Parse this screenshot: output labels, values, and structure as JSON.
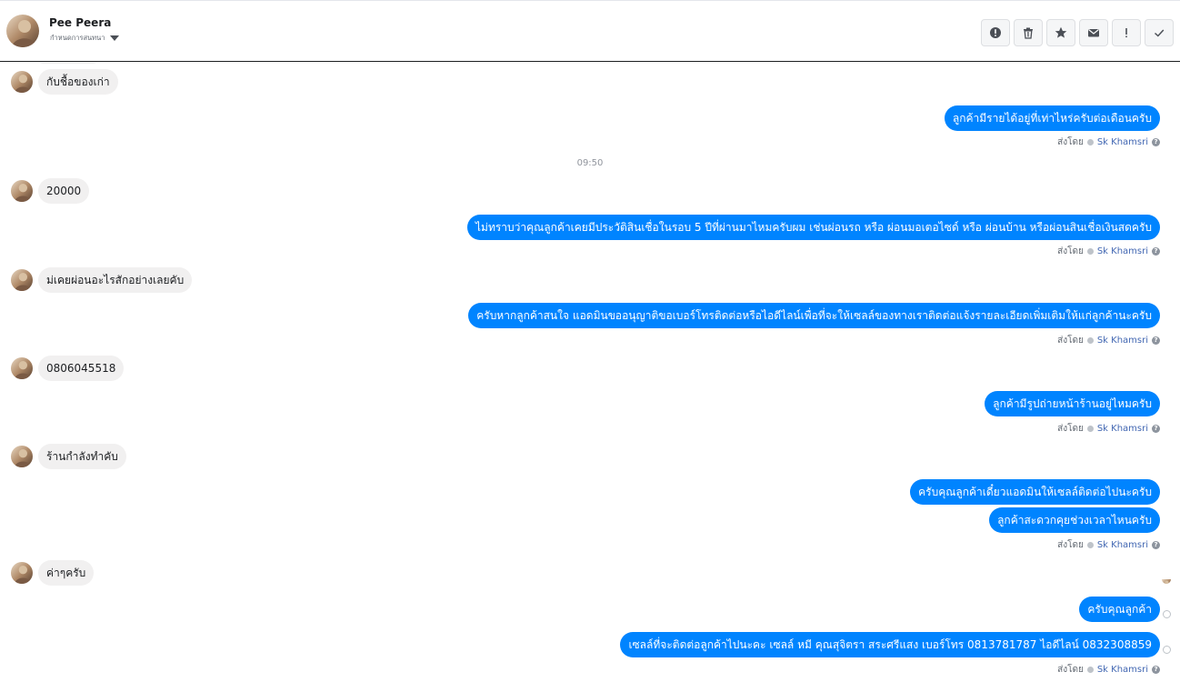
{
  "header": {
    "name": "Pee Peera",
    "subtitle": "กำหนดการสนทนา",
    "actions": [
      "report",
      "delete",
      "star",
      "email",
      "important",
      "done"
    ]
  },
  "timestamp": "09:50",
  "sent_by": {
    "prefix": "ส่งโดย",
    "agent": "Sk Khamsri",
    "help": "?"
  },
  "messages": {
    "in1": "กับชื้อของเก่า",
    "out1": "ลูกค้ามีรายได้อยู่ที่เท่าไหร่ครับต่อเดือนครับ",
    "in2": "20000",
    "out2": "ไม่ทราบว่าคุณลูกค้าเคยมีประวัติสินเชื่อในรอบ 5 ปีที่ผ่านมาไหมครับผม เช่นผ่อนรถ หรือ ผ่อนมอเตอไซด์ หรือ ผ่อนบ้าน หรือผ่อนสินเชื่อเงินสดครับ",
    "in3": "ม่เคยผ่อนอะไรสักอย่างเลยคับ",
    "out3": "ครับหากลูกค้าสนใจ แอดมินขออนุญาติขอเบอร์โทรติดต่อหรือไอดีไลน์เพื่อที่จะให้เซลล์ของทางเราติดต่อแจ้งรายละเอียดเพิ่มเติมให้แก่ลูกค้านะครับ",
    "in4": "0806045518",
    "out4": "ลูกค้ามีรูปถ่ายหน้าร้านอยู่ไหมครับ",
    "in5": "ร้านกำลังทำคับ",
    "out5a": "ครับคุณลูกค้าเดี๋ยวแอดมินให้เซลล์ติดต่อไปนะครับ",
    "out5b": "ลูกค้าสะดวกคุยช่วงเวลาไหนครับ",
    "in6": "ค่าๆครับ",
    "out6a": "ครับคุณลูกค้า",
    "out6b": "เซลล์ที่จะติดต่อลูกค้าไปนะคะ เซลล์ หมี คุณสุจิตรา สระศรีแสง เบอร์โทร 0813781787 ไอดีไลน์ 0832308859"
  },
  "colors": {
    "outgoing": "#0084ff",
    "incoming": "#f1f0f0",
    "agent": "#4267b2"
  }
}
